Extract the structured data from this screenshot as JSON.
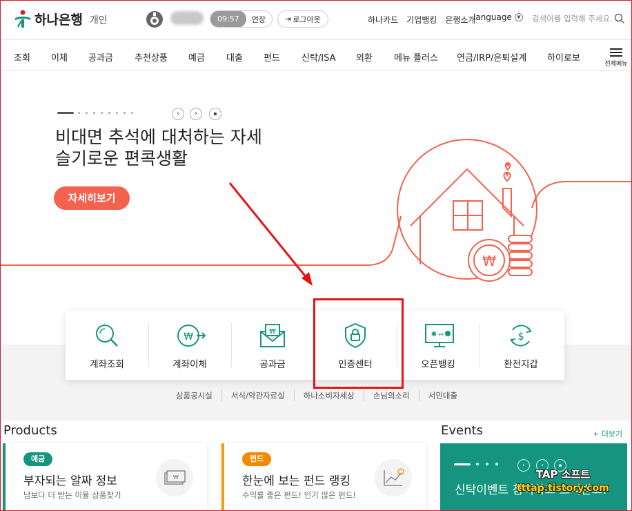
{
  "header": {
    "logo_name": "하나은행",
    "logo_sub": "개인",
    "session_time": "09:57",
    "extend_label": "연장",
    "logout_label": "로그아웃",
    "links": [
      "하나카드",
      "기업뱅킹",
      "은행소개"
    ],
    "language_label": "language",
    "search_placeholder": "검색어를 입력해 주세요."
  },
  "nav": {
    "items": [
      "조회",
      "이체",
      "공과금",
      "추천상품",
      "예금",
      "대출",
      "펀드",
      "신탁/ISA",
      "외환",
      "메뉴 플러스",
      "연금/IRP/은퇴설계",
      "하이로보"
    ],
    "all_menu_label": "전체메뉴"
  },
  "hero": {
    "title_line1": "비대면 추석에 대처하는 자세",
    "title_line2": "슬기로운 편콕생활",
    "cta_label": "자세히보기",
    "accent_color": "#f3614f"
  },
  "quick_menu": [
    {
      "label": "계좌조회",
      "icon": "magnifier-icon"
    },
    {
      "label": "계좌이체",
      "icon": "transfer-icon"
    },
    {
      "label": "공과금",
      "icon": "envelope-won-icon"
    },
    {
      "label": "인증센터",
      "icon": "shield-lock-icon"
    },
    {
      "label": "오픈뱅킹",
      "icon": "monitor-icon"
    },
    {
      "label": "환전지갑",
      "icon": "dollar-exchange-icon"
    }
  ],
  "sub_links": [
    "상품공시실",
    "서식/약관자료실",
    "하나소비자세상",
    "손님의소리",
    "서민대출"
  ],
  "products": {
    "heading": "Products",
    "cards": [
      {
        "badge": "예금",
        "title": "부자되는 알짜 정보",
        "desc": "남보다 더 받는 이율 상품찾기",
        "color": "#15947f"
      },
      {
        "badge": "펀드",
        "title": "한눈에 보는 펀드 랭킹",
        "desc": "수익률 좋은 펀드! 인기 많은 펀드!",
        "color": "#f39c12"
      }
    ]
  },
  "events": {
    "heading": "Events",
    "more_label": "+ 더보기",
    "title": "신탁이벤트 참여하고 스벅받고!",
    "color": "#15947f"
  },
  "watermark": {
    "line1": "TAP 소프트",
    "line2": "tttap.tistory.com"
  }
}
